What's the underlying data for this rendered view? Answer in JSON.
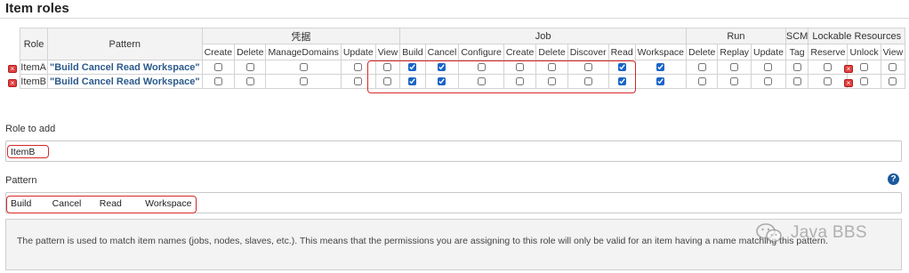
{
  "section": {
    "title": "Item roles"
  },
  "table": {
    "role_header": "Role",
    "pattern_header": "Pattern",
    "groups": [
      "凭据",
      "Job",
      "Run",
      "SCM",
      "Lockable Resources"
    ],
    "permissions": [
      "Create",
      "Delete",
      "ManageDomains",
      "Update",
      "View",
      "Build",
      "Cancel",
      "Configure",
      "Create",
      "Delete",
      "Discover",
      "Read",
      "Workspace",
      "Delete",
      "Replay",
      "Update",
      "Tag",
      "Reserve",
      "Unlock",
      "View"
    ],
    "rows": [
      {
        "role": "ItemA",
        "pattern": "\"Build Cancel Read Workspace\"",
        "checked": [
          false,
          false,
          false,
          false,
          false,
          true,
          true,
          false,
          false,
          false,
          false,
          true,
          true,
          false,
          false,
          false,
          false,
          false,
          false,
          false
        ]
      },
      {
        "role": "ItemB",
        "pattern": "\"Build Cancel Read Workspace\"",
        "checked": [
          false,
          false,
          false,
          false,
          false,
          true,
          true,
          false,
          false,
          false,
          false,
          true,
          true,
          false,
          false,
          false,
          false,
          false,
          false,
          false
        ]
      }
    ]
  },
  "role_to_add": {
    "label": "Role to add",
    "value": "ItemB"
  },
  "pattern_field": {
    "label": "Pattern",
    "value": "Build        Cancel       Read         Workspace"
  },
  "help": {
    "icon": "?",
    "text": "The pattern is used to match item names (jobs, nodes, slaves, etc.). This means that the permissions you are assigning to this role will only be valid for an item having a name matching this pattern."
  },
  "delete_icon": "×",
  "watermark": {
    "text": "Java BBS"
  }
}
